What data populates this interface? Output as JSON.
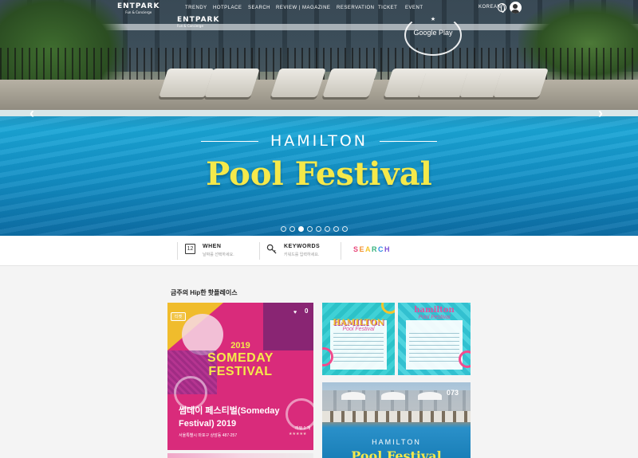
{
  "header": {
    "logo_main": "ENTPARK",
    "logo_sub": "Fun & Concierge",
    "logo_second": "ENTPARK",
    "logo_second_sub": "Fun & Concierge",
    "menu": [
      "TRENDY",
      "HOTPLACE",
      "SEARCH",
      "REVIEW | MAGAZINE",
      "RESERVATION",
      "TICKET",
      "EVENT"
    ],
    "language": "KOREAN"
  },
  "hero": {
    "badge_text": "Google Play",
    "subtitle": "HAMILTON",
    "title": "Pool Festival",
    "slides": 8,
    "active_slide": 3,
    "prev_arrow": "‹",
    "next_arrow": "›"
  },
  "search": {
    "when_label": "WHEN",
    "when_hint": "날짜를 선택하세요.",
    "when_day": "12",
    "keywords_label": "KEYWORDS",
    "keywords_hint": "키워드를 입력하세요.",
    "search_label": "SEARCH"
  },
  "section": {
    "title": "금주의 Hip한 핫플레이스"
  },
  "main_card": {
    "tag": "티켓",
    "fav_count": "0",
    "year": "2019",
    "event_line1": "SOMEDAY",
    "event_line2": "FESTIVAL",
    "title": "썸데이 페스티벌(Someday Festival) 2019",
    "address": "서울특별시 마포구 상암동 487-257",
    "review": "리뷰 1 개",
    "stars": "★★★★★"
  },
  "thumbs": [
    {
      "title": "HAMILTON",
      "sub": "Pool Festival"
    },
    {
      "title": "hamilton",
      "sub": "Pool Festival"
    },
    {
      "title": "HAMILTON",
      "sub": "Pool Festival",
      "number": "073"
    }
  ],
  "colors": {
    "hero_title": "#f5e94a",
    "card_bg": "#d92b7b",
    "accent_yellow": "#f0bc2c"
  }
}
